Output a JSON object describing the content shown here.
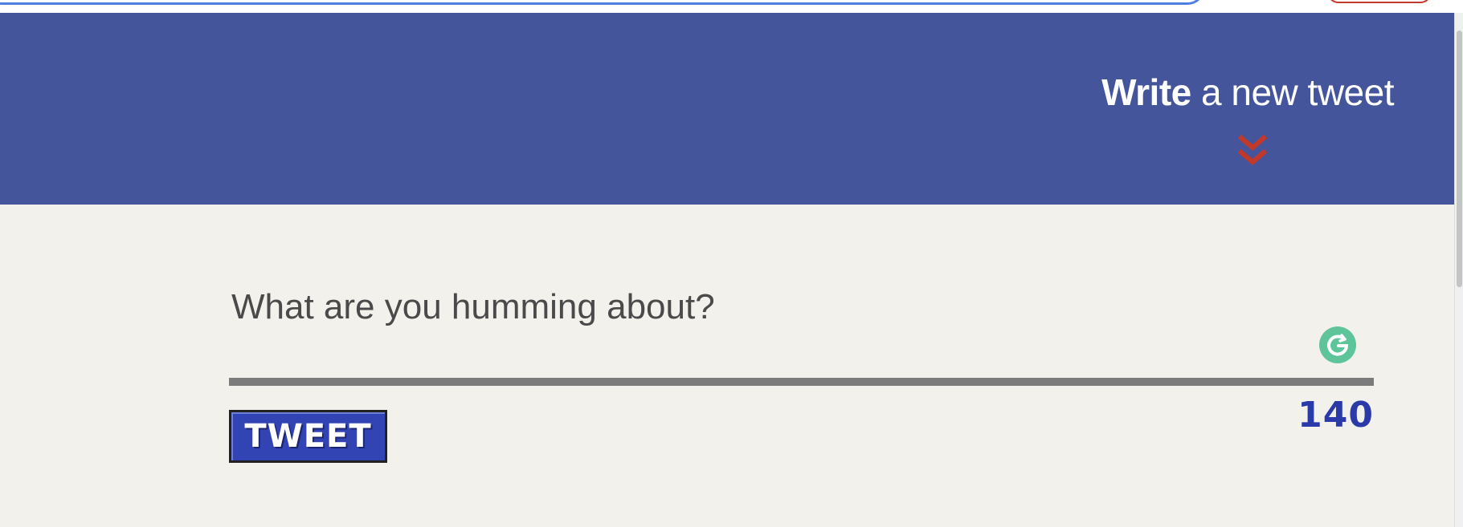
{
  "header": {
    "title_bold": "Write",
    "title_rest": " a new tweet",
    "icon": "double-chevron-down-icon"
  },
  "composer": {
    "placeholder": "What are you humming about?",
    "value": "",
    "grammarly_icon": "grammarly-icon"
  },
  "actions": {
    "tweet_label": "TWEET",
    "char_counter": "140"
  },
  "colors": {
    "header_bg": "#44559b",
    "page_bg": "#f3f1ec",
    "chevron": "#c0392b",
    "button_bg": "#3244b4",
    "counter": "#2a3aa8",
    "grammarly": "#5ec49a"
  }
}
